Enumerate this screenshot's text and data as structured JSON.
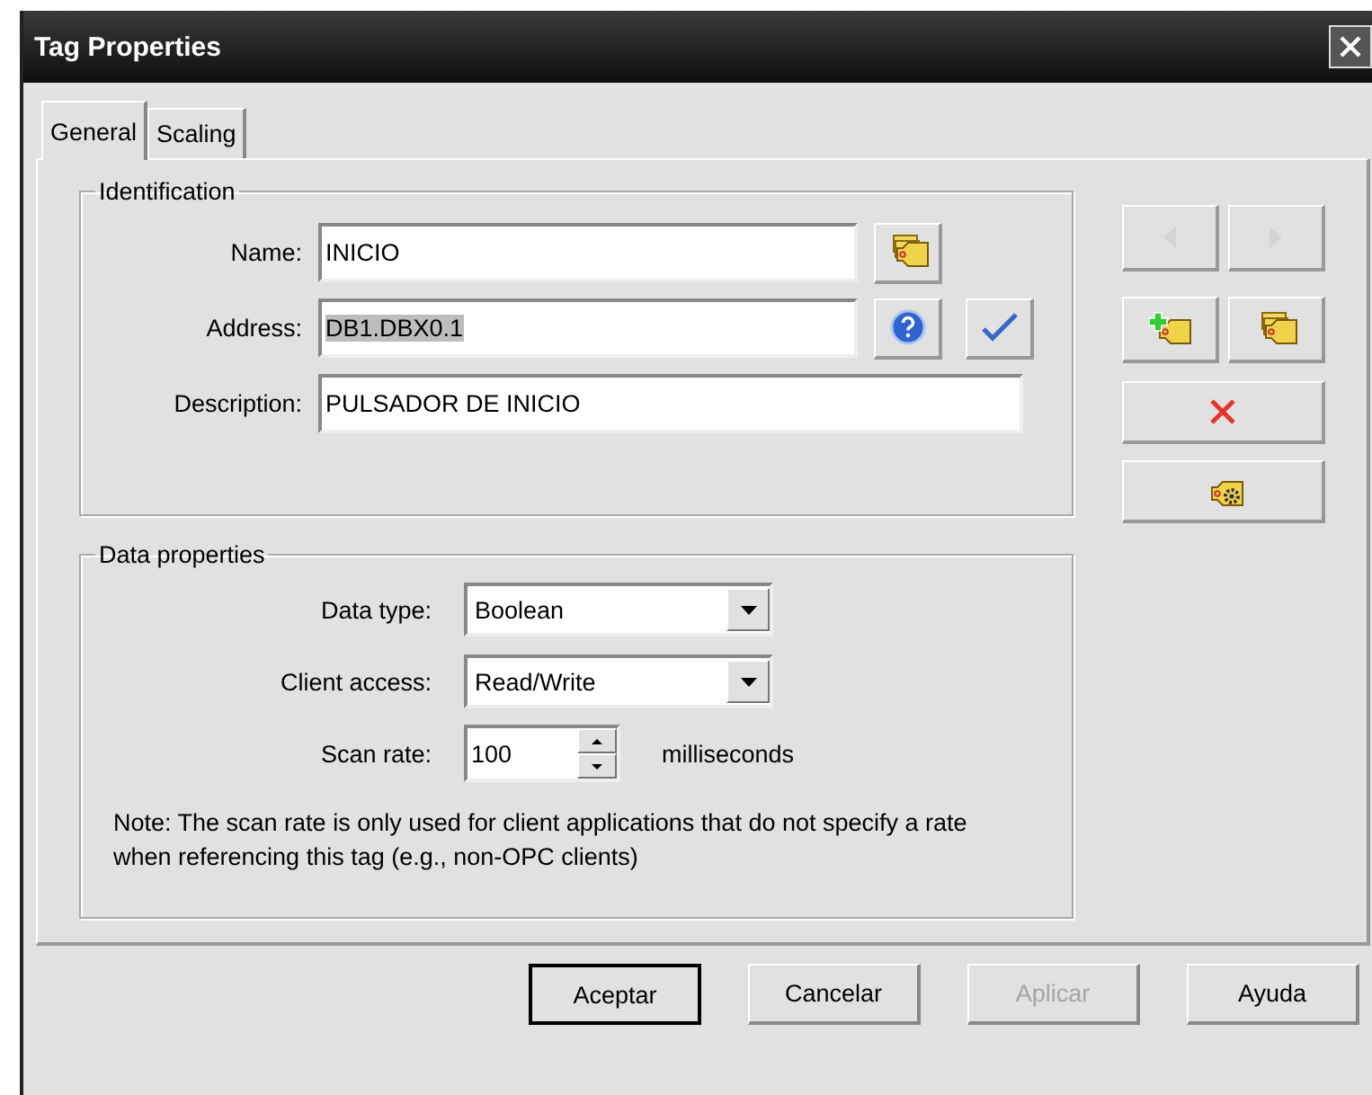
{
  "window": {
    "title": "Tag Properties"
  },
  "tabs": [
    {
      "label": "General",
      "selected": true
    },
    {
      "label": "Scaling",
      "selected": false
    }
  ],
  "identification": {
    "title": "Identification",
    "fields": [
      {
        "kind": "browse",
        "label": "Name:",
        "value": "INICIO",
        "text_selected": false
      },
      {
        "kind": "validate",
        "label": "Address:",
        "value": "DB1.DBX0.1",
        "text_selected": true
      },
      {
        "kind": "plain",
        "label": "Description:",
        "value": "PULSADOR DE INICIO",
        "text_selected": false
      }
    ]
  },
  "data_properties": {
    "title": "Data properties",
    "fields": [
      {
        "kind": "dropdown",
        "label": "Data type:",
        "value": "Boolean"
      },
      {
        "kind": "dropdown",
        "label": "Client access:",
        "value": "Read/Write"
      },
      {
        "kind": "spin",
        "label": "Scan rate:",
        "value": "100",
        "unit": "milliseconds"
      }
    ],
    "note": "Note: The scan rate is only used for client applications that do not specify a rate when referencing this tag (e.g., non-OPC clients)"
  },
  "side_buttons": [
    {
      "kind": "prev",
      "disabled": true
    },
    {
      "kind": "next",
      "disabled": true
    },
    {
      "kind": "new",
      "disabled": false
    },
    {
      "kind": "copy",
      "disabled": false
    },
    {
      "kind": "delete",
      "disabled": false
    },
    {
      "kind": "settings",
      "disabled": false
    }
  ],
  "buttons": [
    {
      "label": "Aceptar",
      "default": true,
      "disabled": false
    },
    {
      "label": "Cancelar",
      "default": false,
      "disabled": false
    },
    {
      "label": "Aplicar",
      "default": false,
      "disabled": true
    },
    {
      "label": "Ayuda",
      "default": false,
      "disabled": false
    }
  ]
}
